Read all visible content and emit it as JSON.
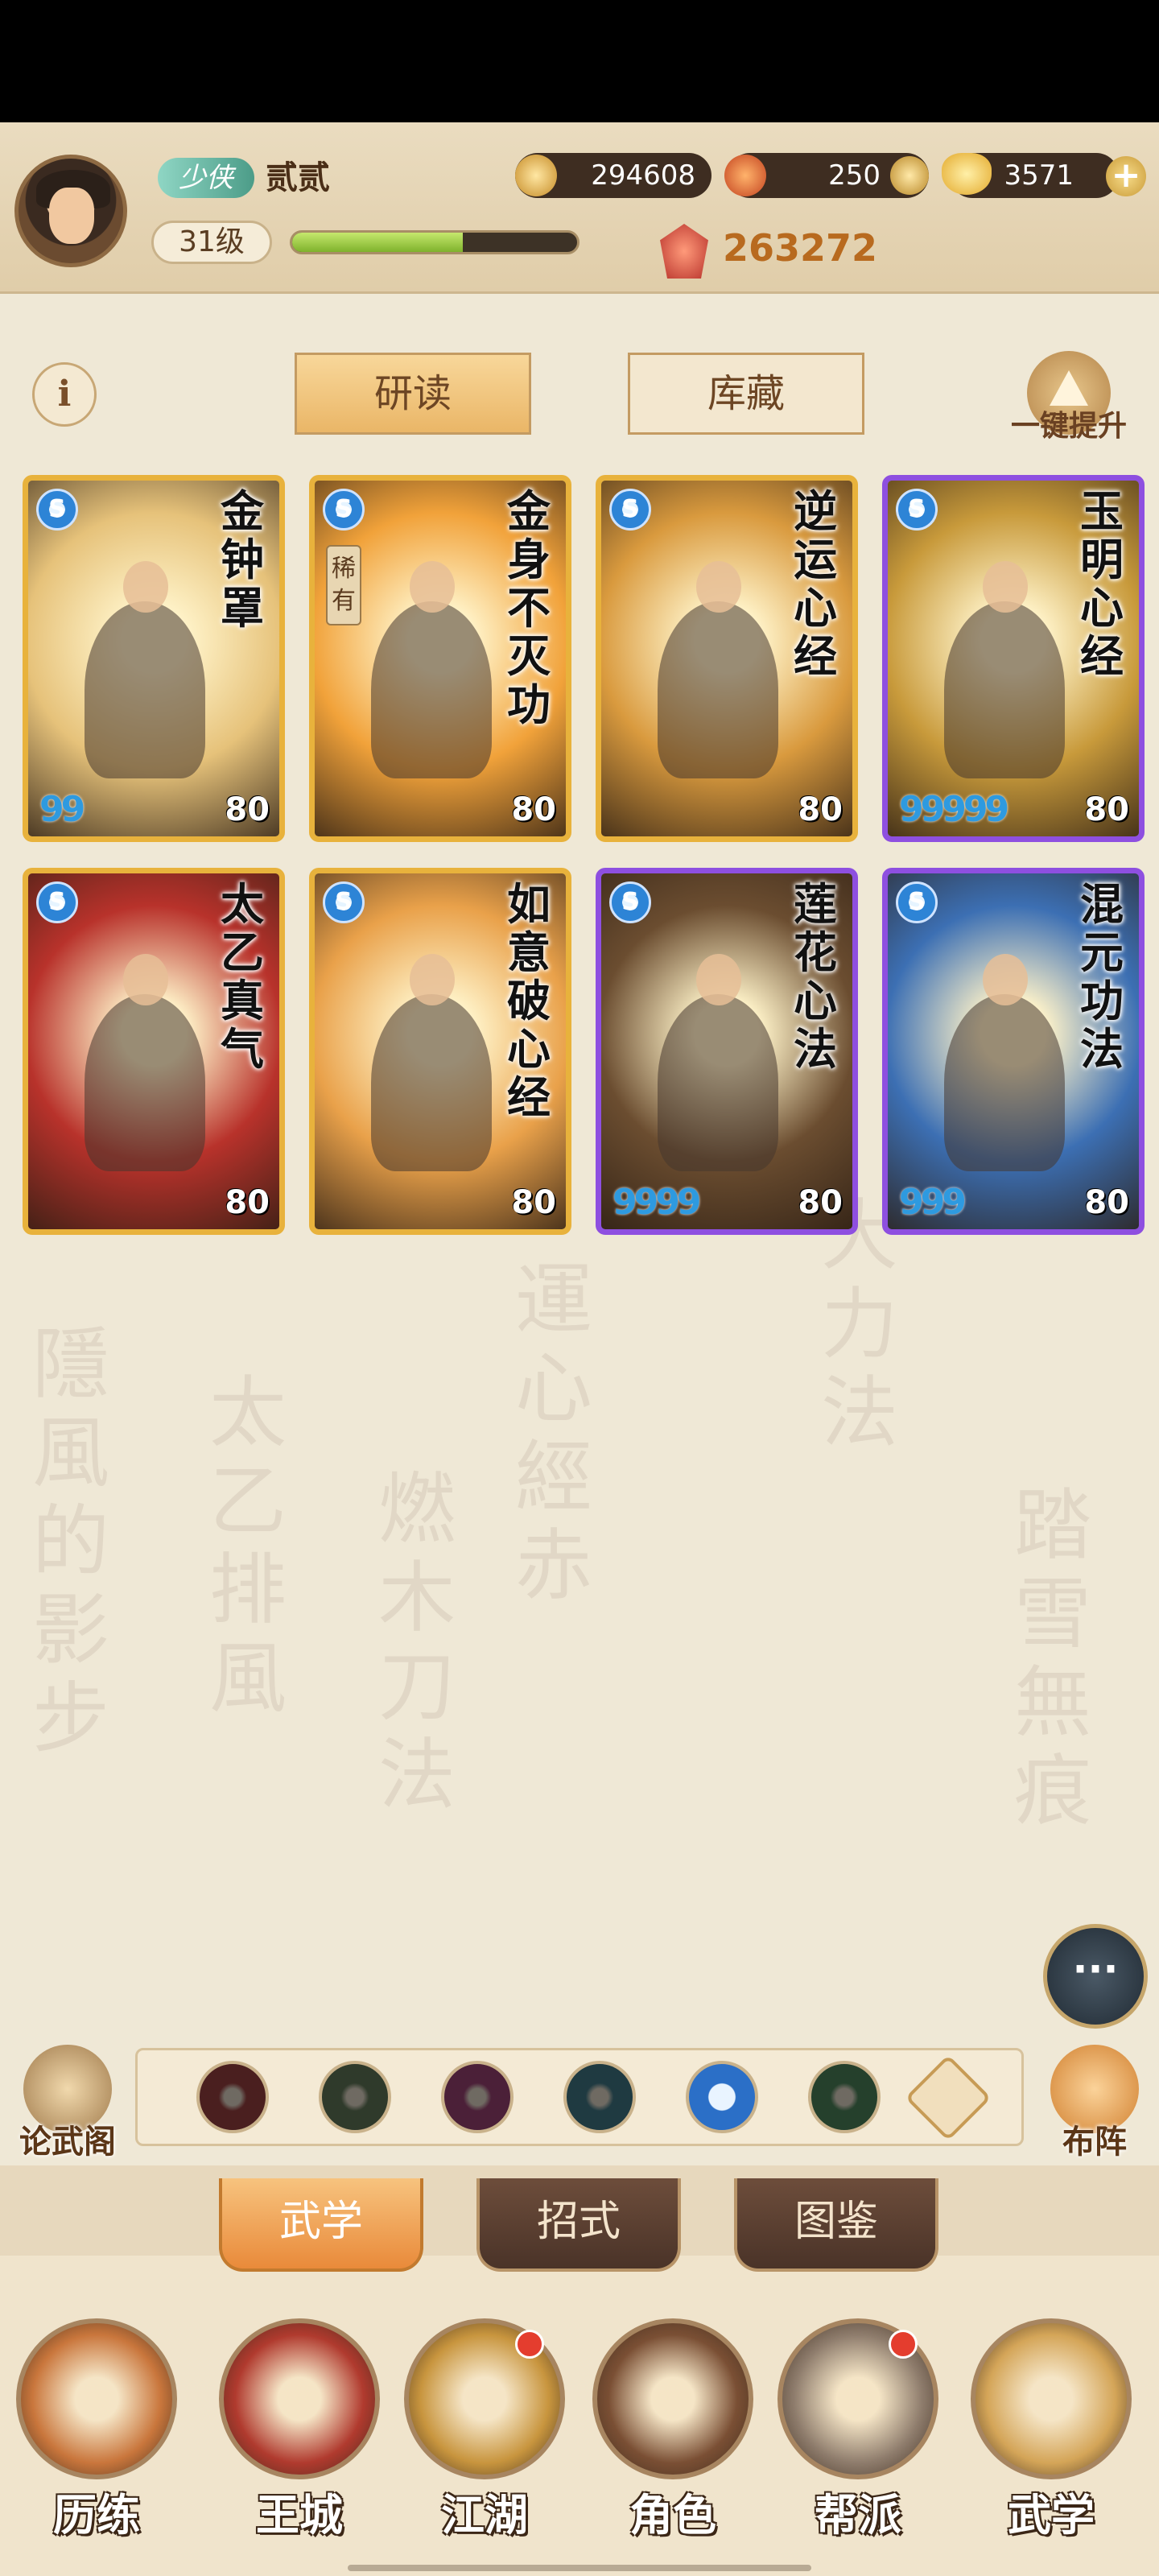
{
  "player": {
    "rank": "少侠",
    "name": "贰贰",
    "level": "31级",
    "exp_fraction": 0.6,
    "power": "263272"
  },
  "currencies": [
    {
      "icon": "coin-icon",
      "value": "294608",
      "color": "#d9a33b"
    },
    {
      "icon": "flame-crystal-icon",
      "value": "250",
      "color": "#d9562c"
    },
    {
      "icon": "gold-ingot-icon",
      "value": "3571",
      "color": "#f0bf3d"
    }
  ],
  "tabs_top": [
    {
      "label": "研读",
      "active": true
    },
    {
      "label": "库藏",
      "active": false
    }
  ],
  "upgrade_all_label": "一键提升",
  "cards": [
    {
      "name": "金钟罩",
      "stars": "99",
      "level": "80",
      "frame": "gold",
      "bg": "#e6c27a",
      "rare": ""
    },
    {
      "name": "金身不灭功",
      "stars": "",
      "level": "80",
      "frame": "gold",
      "bg": "#f1a23a",
      "rare": "稀有"
    },
    {
      "name": "逆运心经",
      "stars": "",
      "level": "80",
      "frame": "gold",
      "bg": "#d99a3e",
      "rare": ""
    },
    {
      "name": "玉明心经",
      "stars": "99999",
      "level": "80",
      "frame": "purple",
      "bg": "#c89a3b",
      "rare": ""
    },
    {
      "name": "太乙真气",
      "stars": "",
      "level": "80",
      "frame": "gold",
      "bg": "#b8322b",
      "rare": ""
    },
    {
      "name": "如意破心经",
      "stars": "",
      "level": "80",
      "frame": "gold",
      "bg": "#e9a14a",
      "rare": ""
    },
    {
      "name": "莲花心法",
      "stars": "9999",
      "level": "80",
      "frame": "purple",
      "bg": "#6b4d30",
      "rare": ""
    },
    {
      "name": "混元功法",
      "stars": "999",
      "level": "80",
      "frame": "purple",
      "bg": "#3c6fb3",
      "rare": ""
    }
  ],
  "skill_slots": [
    {
      "icon": "sword-slot-icon",
      "color": "#4a1f1f"
    },
    {
      "icon": "blade-slot-icon",
      "color": "#2f3a2b"
    },
    {
      "icon": "fist-slot-icon",
      "color": "#4b2038"
    },
    {
      "icon": "palm-slot-icon",
      "color": "#1f3a41"
    },
    {
      "icon": "internal-slot-icon",
      "color": "#2b6fc7"
    },
    {
      "icon": "light-step-slot-icon",
      "color": "#25402c"
    }
  ],
  "forum_label": "论武阁",
  "formation_label": "布阵",
  "sub_tabs": [
    {
      "label": "武学",
      "active": true
    },
    {
      "label": "招式",
      "active": false
    },
    {
      "label": "图鉴",
      "active": false
    }
  ],
  "nav": [
    {
      "label": "历练",
      "icon": "training-icon",
      "badge": false
    },
    {
      "label": "王城",
      "icon": "city-icon",
      "badge": false
    },
    {
      "label": "江湖",
      "icon": "jianghu-icon",
      "badge": true
    },
    {
      "label": "角色",
      "icon": "character-icon",
      "badge": false
    },
    {
      "label": "帮派",
      "icon": "guild-icon",
      "badge": true
    },
    {
      "label": "武学",
      "icon": "martial-arts-icon",
      "badge": false
    }
  ]
}
